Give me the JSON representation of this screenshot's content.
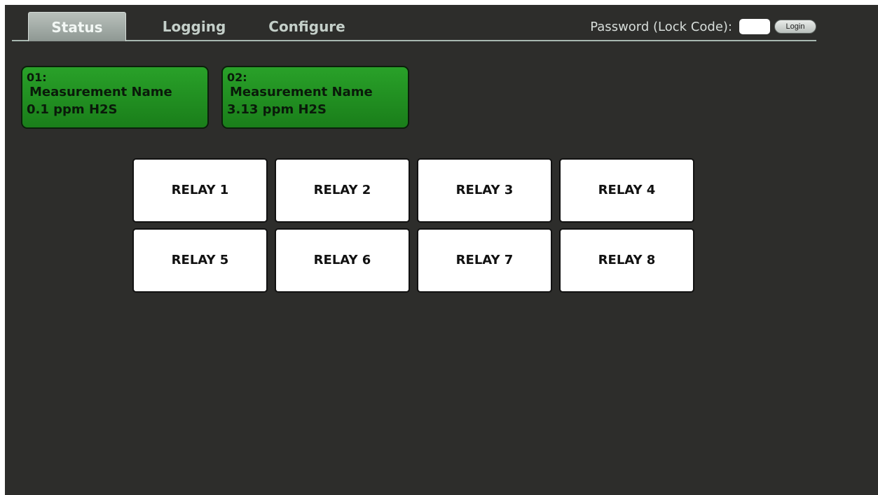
{
  "tabs": [
    {
      "label": "Status",
      "active": true
    },
    {
      "label": "Logging",
      "active": false
    },
    {
      "label": "Configure",
      "active": false
    }
  ],
  "login": {
    "label": "Password (Lock Code):",
    "input_value": "",
    "button_label": "Login"
  },
  "measurements": [
    {
      "id": "01:",
      "name": "Measurement Name",
      "value": "0.1 ppm H2S",
      "status_color": "#1f8f1f"
    },
    {
      "id": "02:",
      "name": "Measurement Name",
      "value": "3.13 ppm H2S",
      "status_color": "#1f8f1f"
    }
  ],
  "relays": [
    {
      "label": "RELAY 1"
    },
    {
      "label": "RELAY 2"
    },
    {
      "label": "RELAY 3"
    },
    {
      "label": "RELAY 4"
    },
    {
      "label": "RELAY 5"
    },
    {
      "label": "RELAY 6"
    },
    {
      "label": "RELAY 7"
    },
    {
      "label": "RELAY 8"
    }
  ],
  "colors": {
    "background": "#2d2d2b",
    "tab_text": "#c4cfc9",
    "measurement_ok": "#1f8f1f",
    "relay_off": "#ffffff"
  }
}
